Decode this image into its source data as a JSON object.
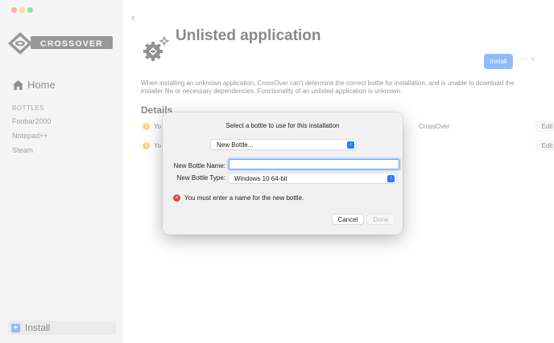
{
  "sidebar": {
    "logo_text": "CROSSOVER",
    "home_label": "Home",
    "bottles_heading": "BOTTLES",
    "bottles": [
      "Foobar2000",
      "Notepad++",
      "Steam"
    ],
    "install_label": "Install"
  },
  "main": {
    "title": "Unlisted application",
    "install_button": "Install",
    "more_button": "⋯ ˅",
    "description": "When installing an unknown application, CrossOver can't determine the correct bottle for installation, and is unable to download the installer file or necessary dependencies. Functionality of an unlisted application is unknown.",
    "details_heading": "Details",
    "detail_rows": [
      {
        "text": "Yo",
        "right_text": "CrossOver",
        "edit_label": "Edit"
      },
      {
        "text": "Yo",
        "right_text": "",
        "edit_label": "Edit"
      }
    ]
  },
  "dialog": {
    "title": "Select a bottle to use for this installation",
    "bottle_select_value": "New Bottle...",
    "name_label": "New Bottle Name:",
    "name_value": "",
    "type_label": "New Bottle Type:",
    "type_value": "Windows 10 64-bit",
    "error_message": "You must enter a name for the new bottle.",
    "cancel_label": "Cancel",
    "done_label": "Done"
  },
  "colors": {
    "accent": "#2b7cf6",
    "error": "#e5443b",
    "warning": "#f5b400"
  },
  "icons": {
    "home": "house-icon",
    "app": "gear-sparkle-icon",
    "back": "chevron-left-icon",
    "error": "x-circle-icon",
    "warning": "exclamation-circle-icon"
  }
}
